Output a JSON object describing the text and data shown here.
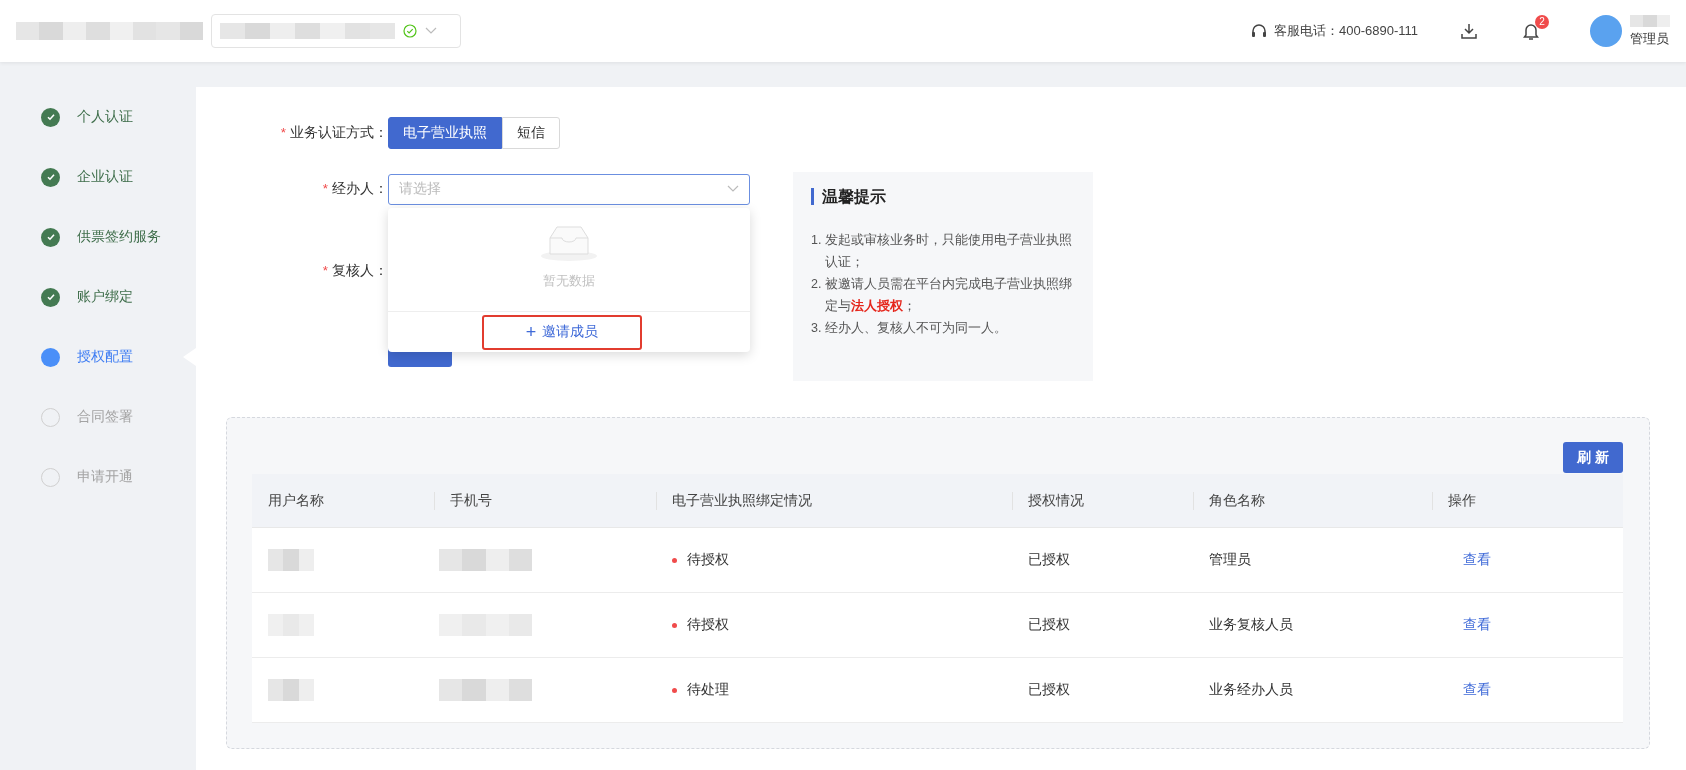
{
  "header": {
    "phone_label": "客服电话：400-6890-111",
    "notification_count": "2",
    "role": "管理员"
  },
  "steps": [
    {
      "label": "个人认证",
      "completed": true,
      "selected": false
    },
    {
      "label": "企业认证",
      "completed": true,
      "selected": false
    },
    {
      "label": "供票签约服务",
      "completed": true,
      "selected": false
    },
    {
      "label": "账户绑定",
      "completed": true,
      "selected": false
    },
    {
      "label": "授权配置",
      "completed": false,
      "selected": true
    },
    {
      "label": "合同签署",
      "completed": false,
      "selected": false
    },
    {
      "label": "申请开通",
      "completed": false,
      "selected": false
    }
  ],
  "form": {
    "auth_method": {
      "asterisk": "*",
      "label": "业务认证方式：",
      "options": [
        {
          "label": "电子营业执照",
          "selected": true
        },
        {
          "label": "短信",
          "selected": false
        }
      ]
    },
    "handler": {
      "asterisk": "*",
      "label": "经办人：",
      "placeholder": "请选择",
      "expanded": true
    },
    "reviewer": {
      "asterisk": "*",
      "label": "复核人："
    },
    "dropdown": {
      "empty_text": "暂无数据",
      "action_icon": "+",
      "action": "邀请成员",
      "highlighted": true
    }
  },
  "tips": {
    "title": "温馨提示",
    "items": [
      {
        "number": "1.",
        "text": "发起或审核业务时，只能使用电子营业执照认证；"
      },
      {
        "number": "2.",
        "text": "被邀请人员需在平台内完成电子营业执照绑定与**法人授权**；"
      },
      {
        "number": "3.",
        "text": "经办人、复核人不可为同一人。"
      }
    ]
  },
  "table": {
    "refresh": "刷 新",
    "columns": [
      "用户名称",
      "手机号",
      "电子营业执照绑定情况",
      "授权情况",
      "角色名称",
      "操作"
    ],
    "rows": [
      {
        "binding": "待授权",
        "color": "#f04b4b",
        "auth": "已授权",
        "role": "管理员",
        "action": "查看"
      },
      {
        "binding": "待授权",
        "color": "#f04b4b",
        "auth": "已授权",
        "role": "业务复核人员",
        "action": "查看"
      },
      {
        "binding": "待处理",
        "color": "#f04b4b",
        "auth": "已授权",
        "role": "业务经办人员",
        "action": "查看"
      }
    ]
  }
}
